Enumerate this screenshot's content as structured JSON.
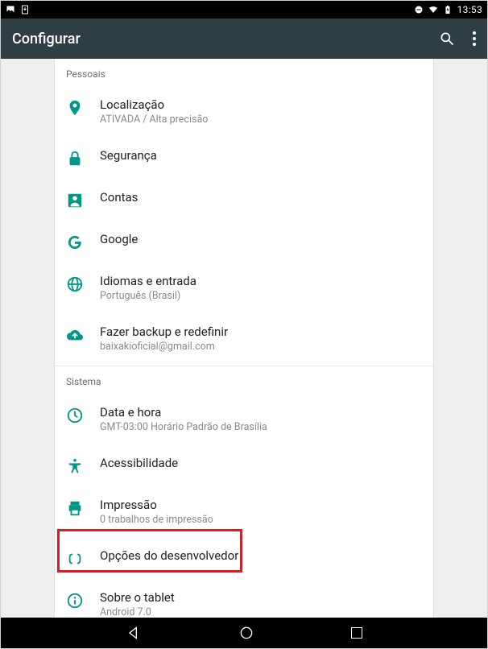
{
  "statusbar": {
    "time": "13:53"
  },
  "appbar": {
    "title": "Configurar"
  },
  "sections": {
    "pessoais": {
      "header": "Pessoais",
      "items": {
        "localizacao": {
          "title": "Localização",
          "sub": "ATIVADA / Alta precisão"
        },
        "seguranca": {
          "title": "Segurança"
        },
        "contas": {
          "title": "Contas"
        },
        "google": {
          "title": "Google"
        },
        "idiomas": {
          "title": "Idiomas e entrada",
          "sub": "Português (Brasil)"
        },
        "backup": {
          "title": "Fazer backup e redefinir",
          "sub": "baixakioficial@gmail.com"
        }
      }
    },
    "sistema": {
      "header": "Sistema",
      "items": {
        "datahora": {
          "title": "Data e hora",
          "sub": "GMT-03:00 Horário Padrão de Brasília"
        },
        "acessibilidade": {
          "title": "Acessibilidade"
        },
        "impressao": {
          "title": "Impressão",
          "sub": "0 trabalhos de impressão"
        },
        "desenvolvedor": {
          "title": "Opções do desenvolvedor"
        },
        "sobre": {
          "title": "Sobre o tablet",
          "sub": "Android 7.0"
        }
      }
    }
  },
  "colors": {
    "accent": "#009688",
    "highlight": "#d62027"
  }
}
